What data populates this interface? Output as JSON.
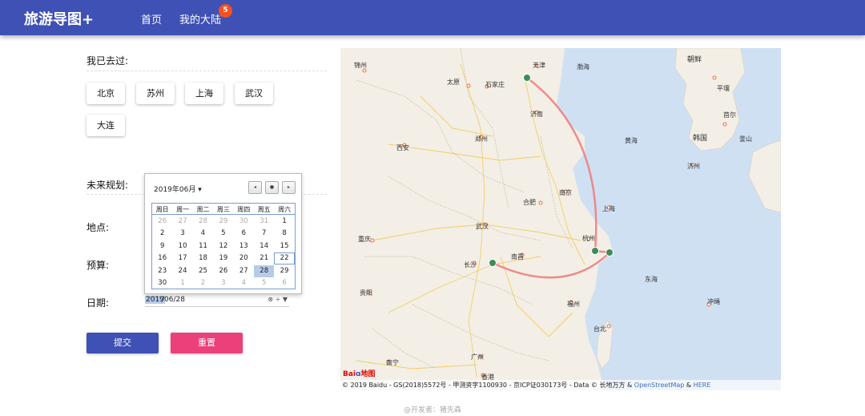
{
  "header": {
    "brand": "旅游导图+",
    "nav": [
      {
        "label": "首页"
      },
      {
        "label": "我的大陆",
        "badge": "5"
      }
    ]
  },
  "visited": {
    "label": "我已去过:",
    "cities": [
      "北京",
      "苏州",
      "上海",
      "武汉",
      "大连"
    ]
  },
  "plan": {
    "label": "未来规划:",
    "place_label": "地点:",
    "budget_label": "预算:",
    "date_label": "日期:",
    "date_value": "2019/06/28",
    "date_year_part": "2019",
    "date_rest_part": "/06/28",
    "date_controls": "⊗ ÷ ▼",
    "submit": "提交",
    "reset": "重置"
  },
  "calendar": {
    "month": "2019年06月 ▾",
    "nav": [
      "◂",
      "●",
      "▸"
    ],
    "weekdays": [
      "周日",
      "周一",
      "周二",
      "周三",
      "周四",
      "周五",
      "周六"
    ],
    "weeks": [
      [
        "26",
        "27",
        "28",
        "29",
        "30",
        "31",
        "1"
      ],
      [
        "2",
        "3",
        "4",
        "5",
        "6",
        "7",
        "8"
      ],
      [
        "9",
        "10",
        "11",
        "12",
        "13",
        "14",
        "15"
      ],
      [
        "16",
        "17",
        "18",
        "19",
        "20",
        "21",
        "22"
      ],
      [
        "23",
        "24",
        "25",
        "26",
        "27",
        "28",
        "29"
      ],
      [
        "30",
        "1",
        "2",
        "3",
        "4",
        "5",
        "6"
      ]
    ],
    "today": "22",
    "selected": "28"
  },
  "map": {
    "labels": [
      {
        "text": "锦州"
      },
      {
        "text": "天津"
      },
      {
        "text": "渤海"
      },
      {
        "text": "太原"
      },
      {
        "text": "石家庄"
      },
      {
        "text": "济南"
      },
      {
        "text": "西安"
      },
      {
        "text": "郑州"
      },
      {
        "text": "黄海"
      },
      {
        "text": "合肥"
      },
      {
        "text": "南京"
      },
      {
        "text": "上海"
      },
      {
        "text": "武汉"
      },
      {
        "text": "杭州"
      },
      {
        "text": "重庆"
      },
      {
        "text": "长沙"
      },
      {
        "text": "南昌"
      },
      {
        "text": "东海"
      },
      {
        "text": "贵阳"
      },
      {
        "text": "福州"
      },
      {
        "text": "台北"
      },
      {
        "text": "南宁"
      },
      {
        "text": "广州"
      },
      {
        "text": "香港"
      },
      {
        "text": "朝鲜"
      },
      {
        "text": "韩国"
      },
      {
        "text": "济州"
      },
      {
        "text": "冲绳"
      },
      {
        "text": "平壤"
      },
      {
        "text": "首尔"
      },
      {
        "text": "釜山"
      }
    ],
    "copyright_main": "© 2019 Baidu - GS(2018)5572号 - 甲测资字1100930 - 京ICP证030173号 - Data © 长地万方 &",
    "copyright_osm": "OpenStreetMap",
    "copyright_amp": "&",
    "copyright_here": "HERE",
    "logo": "Bai",
    "logo_paw": "ɑ",
    "logo_tail": "地图"
  },
  "footer": "@开发者：猪先森",
  "colors": {
    "primary": "#3f51b5",
    "reset": "#ec407a",
    "route": "#f08080",
    "marker": "#3d8b5a",
    "sea": "#cfe0f3"
  }
}
